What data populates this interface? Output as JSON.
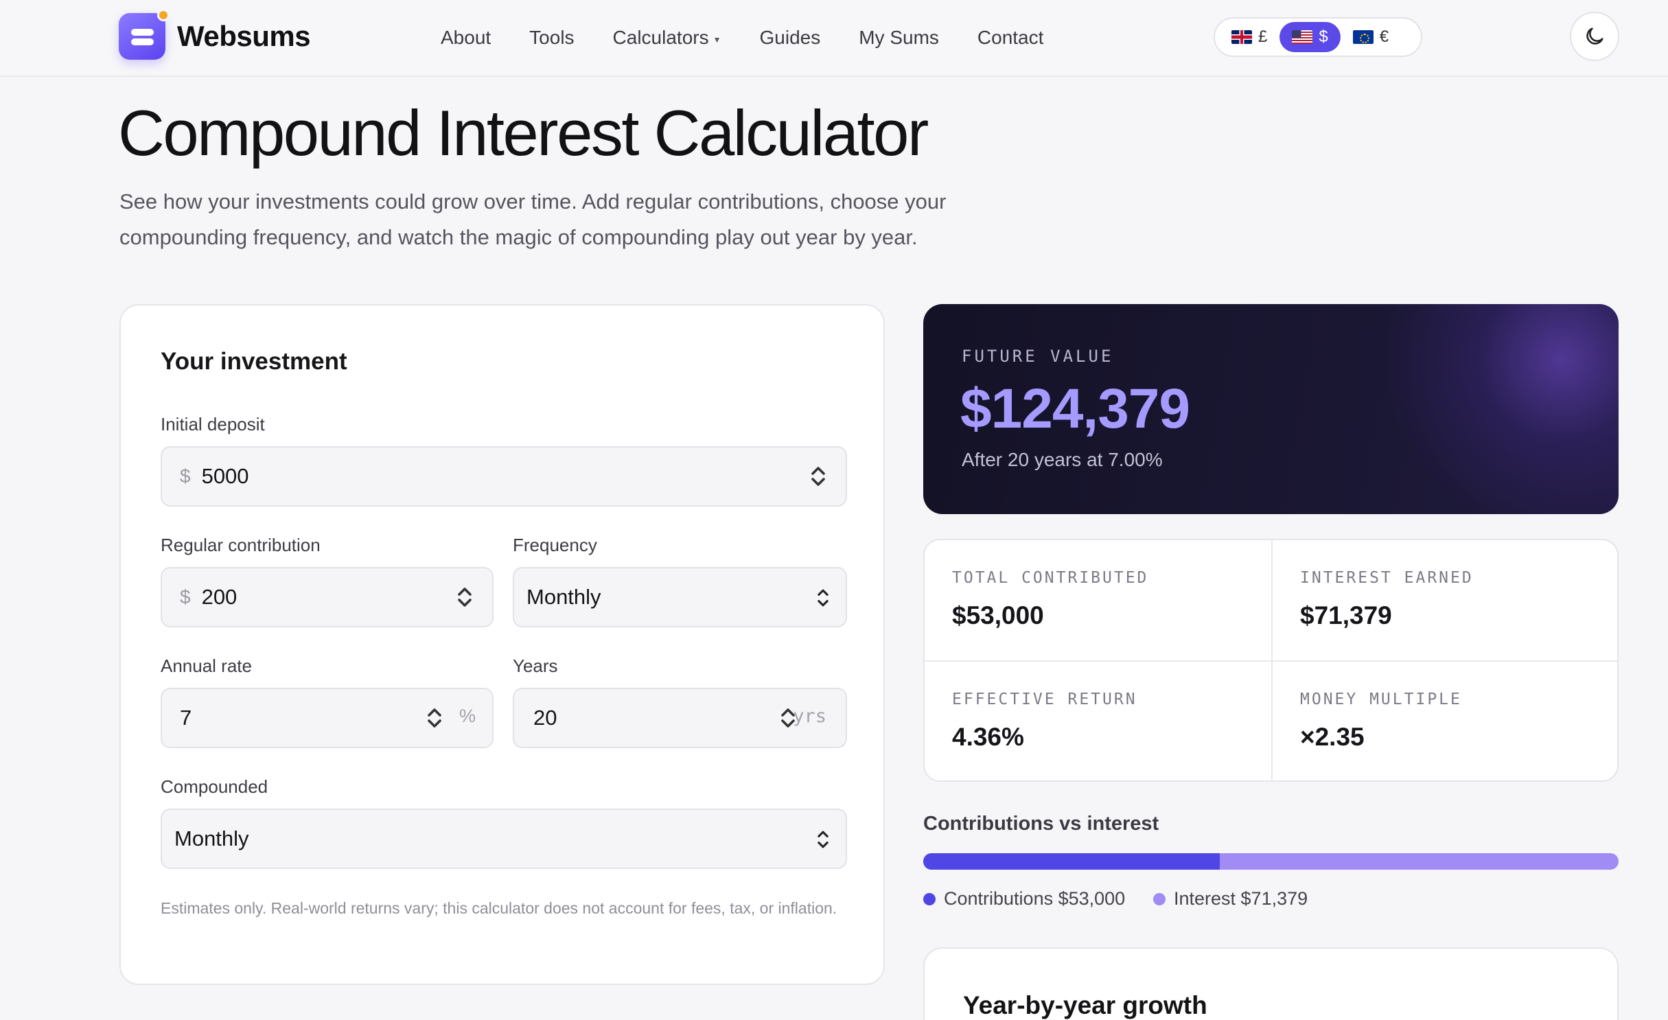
{
  "brand": {
    "name": "Websums"
  },
  "nav": {
    "items": [
      {
        "label": "About"
      },
      {
        "label": "Tools"
      },
      {
        "label": "Calculators"
      },
      {
        "label": "Guides"
      },
      {
        "label": "My Sums"
      },
      {
        "label": "Contact"
      }
    ]
  },
  "currency": {
    "options": [
      {
        "symbol": "£",
        "flag": "uk-flag-icon"
      },
      {
        "symbol": "$",
        "flag": "us-flag-icon",
        "active": true
      },
      {
        "symbol": "€",
        "flag": "eu-flag-icon"
      }
    ]
  },
  "theme_toggle": {
    "icon": "moon-icon"
  },
  "page": {
    "title": "Compound Interest Calculator",
    "description": "See how your investments could grow over time. Add regular contributions, choose your compounding frequency, and watch the magic of compounding play out year by year."
  },
  "form": {
    "title": "Your investment",
    "initial_deposit": {
      "label": "Initial deposit",
      "prefix": "$",
      "value": "5000"
    },
    "regular_contribution": {
      "label": "Regular contribution",
      "prefix": "$",
      "value": "200"
    },
    "frequency": {
      "label": "Frequency",
      "value": "Monthly"
    },
    "annual_rate": {
      "label": "Annual rate",
      "value": "7",
      "suffix": "%"
    },
    "years": {
      "label": "Years",
      "value": "20",
      "suffix": "yrs"
    },
    "compounded": {
      "label": "Compounded",
      "value": "Monthly"
    },
    "disclaimer": "Estimates only. Real-world returns vary; this calculator does not account for fees, tax, or inflation."
  },
  "result": {
    "label": "FUTURE VALUE",
    "value": "$124,379",
    "sub": "After 20 years at 7.00%"
  },
  "stats": {
    "total_contributed": {
      "label": "TOTAL CONTRIBUTED",
      "value": "$53,000"
    },
    "interest_earned": {
      "label": "INTEREST EARNED",
      "value": "$71,379"
    },
    "effective_return": {
      "label": "EFFECTIVE RETURN",
      "value": "4.36%"
    },
    "money_multiple": {
      "label": "MONEY MULTIPLE",
      "value": "×2.35"
    }
  },
  "breakdown": {
    "title": "Contributions vs interest",
    "contributions_fraction": 0.4261,
    "contributions_legend": "Contributions $53,000",
    "interest_legend": "Interest $71,379",
    "contributions_color": "#4f46e5",
    "interest_color": "#a18bf5"
  },
  "growth": {
    "title": "Year-by-year growth"
  },
  "colors": {
    "accent": "#5b4ae8",
    "future_value": "#a49aff"
  }
}
